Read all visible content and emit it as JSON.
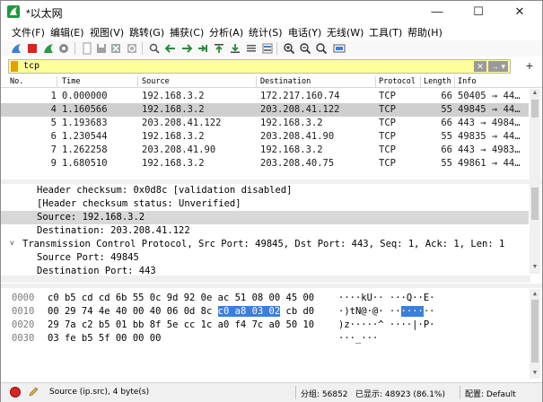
{
  "window": {
    "title": "*以太网",
    "minimize": "—",
    "maximize": "☐",
    "close": "✕"
  },
  "menu": [
    "文件(F)",
    "编辑(E)",
    "视图(V)",
    "跳转(G)",
    "捕获(C)",
    "分析(A)",
    "统计(S)",
    "电话(Y)",
    "无线(W)",
    "工具(T)",
    "帮助(H)"
  ],
  "filter": {
    "value": "tcp",
    "clear_label": "✕",
    "apply_label": "→ ▾",
    "add_label": "+"
  },
  "packet_list": {
    "headers": {
      "no": "No.",
      "time": "Time",
      "source": "Source",
      "destination": "Destination",
      "protocol": "Protocol",
      "length": "Length",
      "info": "Info"
    },
    "rows": [
      {
        "no": "1",
        "time": "0.000000",
        "source": "192.168.3.2",
        "destination": "172.217.160.74",
        "protocol": "TCP",
        "length": "66",
        "info": "50405 → 44…"
      },
      {
        "no": "4",
        "time": "1.160566",
        "source": "192.168.3.2",
        "destination": "203.208.41.122",
        "protocol": "TCP",
        "length": "55",
        "info": "49845 → 44…"
      },
      {
        "no": "5",
        "time": "1.193683",
        "source": "203.208.41.122",
        "destination": "192.168.3.2",
        "protocol": "TCP",
        "length": "66",
        "info": "443 → 4984…"
      },
      {
        "no": "6",
        "time": "1.230544",
        "source": "192.168.3.2",
        "destination": "203.208.41.90",
        "protocol": "TCP",
        "length": "55",
        "info": "49835 → 44…"
      },
      {
        "no": "7",
        "time": "1.262258",
        "source": "203.208.41.90",
        "destination": "192.168.3.2",
        "protocol": "TCP",
        "length": "66",
        "info": "443 → 4983…"
      },
      {
        "no": "9",
        "time": "1.680510",
        "source": "192.168.3.2",
        "destination": "203.208.40.75",
        "protocol": "TCP",
        "length": "55",
        "info": "49861 → 44…"
      }
    ]
  },
  "details": {
    "lines": [
      "Header checksum: 0x0d8c [validation disabled]",
      "[Header checksum status: Unverified]",
      "Source: 192.168.3.2",
      "Destination: 203.208.41.122",
      "Transmission Control Protocol, Src Port: 49845, Dst Port: 443, Seq: 1, Ack: 1, Len: 1",
      "Source Port: 49845",
      "Destination Port: 443"
    ],
    "expander": "v"
  },
  "bytes": {
    "rows": [
      {
        "offset": "0000",
        "hex_pre": "c0 b5 cd cd 6b 55 0c 9d  92 0e ac 51 08 00 45 00",
        "hex_hl": "",
        "hex_post": "",
        "ascii_pre": "····kU·· ···Q··E·",
        "ascii_hl": "",
        "ascii_post": ""
      },
      {
        "offset": "0010",
        "hex_pre": "00 29 74 4e 40 00 40 06  0d 8c ",
        "hex_hl": "c0 a8 03 02",
        "hex_post": " cb d0",
        "ascii_pre": "·)tN@·@· ··",
        "ascii_hl": "····",
        "ascii_post": "··"
      },
      {
        "offset": "0020",
        "hex_pre": "29 7a c2 b5 01 bb 8f 5e  cc 1c a0 f4 7c a0 50 10",
        "hex_hl": "",
        "hex_post": "",
        "ascii_pre": ")z·····^ ····|·P·",
        "ascii_hl": "",
        "ascii_post": ""
      },
      {
        "offset": "0030",
        "hex_pre": "03 fe b5 5f 00 00 00",
        "hex_hl": "",
        "hex_post": "",
        "ascii_pre": "···_···",
        "ascii_hl": "",
        "ascii_post": ""
      }
    ]
  },
  "status": {
    "field": "Source (ip.src), 4 byte(s)",
    "packets": "分组: 56852",
    "displayed": "已显示: 48923 (86.1%)",
    "profile": "配置: Default"
  },
  "colors": {
    "selected_row": "#cfcfcf",
    "filter_bg": "#ffff9a",
    "byte_highlight": "#3a7fdc",
    "detail_highlight": "#d8d8d8"
  },
  "icons": {
    "app": "wireshark-fin-icon",
    "toolbar": [
      "shark-start-icon",
      "stop-square-icon",
      "restart-icon",
      "options-gear-icon",
      "open-file-icon",
      "save-file-icon",
      "close-file-icon",
      "reload-icon",
      "find-icon",
      "go-back-icon",
      "go-forward-icon",
      "go-to-packet-icon",
      "go-first-icon",
      "go-last-icon",
      "autoscroll-icon",
      "colorize-icon",
      "zoom-in-icon",
      "zoom-out-icon",
      "zoom-normal-icon",
      "resize-columns-icon"
    ]
  }
}
